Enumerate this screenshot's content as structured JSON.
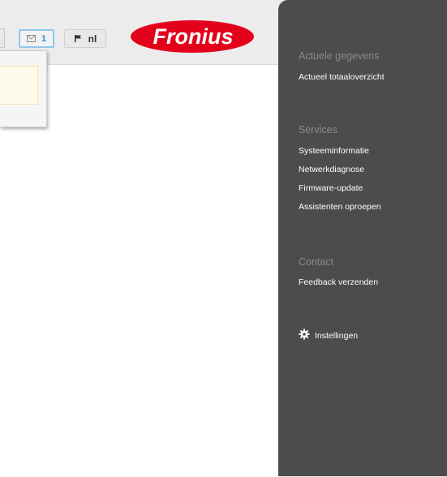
{
  "topbar": {
    "message_count": "1",
    "language": "nl",
    "logo_text": "Fronius"
  },
  "sidebar": {
    "sections": [
      {
        "title": "Actuele gegevens",
        "links": [
          "Actueel totaaloverzicht"
        ]
      },
      {
        "title": "Services",
        "links": [
          "Systeeminformatie",
          "Netwerkdiagnose",
          "Firmware-update",
          "Assistenten oproepen"
        ]
      },
      {
        "title": "Contact",
        "links": [
          "Feedback verzenden"
        ]
      }
    ],
    "settings_label": "Instellingen"
  },
  "colors": {
    "sidebar_bg": "#4c4c4c",
    "logo_red": "#e3001b",
    "message_accent": "#2f8fd0"
  },
  "icons": [
    "mail-icon",
    "flag-icon",
    "gear-icon"
  ]
}
